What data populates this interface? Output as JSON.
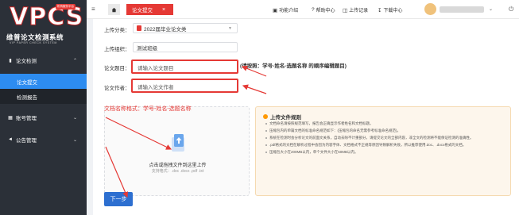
{
  "logo": {
    "brand": "VPCS",
    "badge": "机构服务平台",
    "name_cn": "维普论文检测系统",
    "name_en": "VIP PAPER CHECK SYSTEM"
  },
  "sidebar": {
    "menus": [
      {
        "label": "论文检测",
        "icon": "document-icon"
      },
      {
        "label": "账号管理",
        "icon": "user-card-icon"
      },
      {
        "label": "公告管理",
        "icon": "megaphone-icon"
      }
    ],
    "submenu": [
      {
        "label": "论文提交",
        "active": true
      },
      {
        "label": "检测报告",
        "active": false
      }
    ]
  },
  "topbar": {
    "menu_toggle": "≡",
    "active_tab": "论文提交",
    "tab_close": "×",
    "links": [
      {
        "label": "功能介绍",
        "icon": "feature-icon"
      },
      {
        "label": "帮助中心",
        "icon": "help-icon"
      },
      {
        "label": "上传记录",
        "icon": "upload-record-icon"
      },
      {
        "label": "下载中心",
        "icon": "download-icon"
      }
    ]
  },
  "form": {
    "category_label": "上传分类：",
    "category_value": "2022届毕业论文类",
    "org_label": "上传组织：",
    "org_value": "测试班级",
    "title_label": "论文题目：",
    "title_placeholder": "请输入论文题目",
    "title_hint": "(请按照：学号-姓名-选题名称 的顺序编辑题目)",
    "author_label": "论文作者：",
    "author_placeholder": "请输入论文作者",
    "format_note": "文档名称格式：学号-姓名-选题名称"
  },
  "upload": {
    "title": "点击或拖拽文件到这里上传",
    "formats": "支持格式：.doc .docx .pdf .txt"
  },
  "rules": {
    "title": "上传文件规则",
    "items": [
      "文档命名请按照规范填写，报告会正确显示作者姓名和文档标题。",
      "压缩包内的单篇文档的标准命名规范如下：(压缩包的命名无需参考标准命名规范)。",
      "系统在检测时会分析论文的前面文关系，自动去除不计重部分，请提交论文的全部内容，非全文的检测将不能保证检测的准确性。",
      ".pdf格式的文档在解析过程中会因为内容字体、文档格式不正规等原因导致解析失败，所以推荐使用.doc、.docx格式的文档。",
      "压缩包大小在200MB以内，单个文件大小在50MB以内。"
    ]
  },
  "buttons": {
    "next": "下一步"
  },
  "colors": {
    "sidebar_bg": "#2b3038",
    "accent_blue": "#2d8cf0",
    "tab_red": "#e53935",
    "highlight_red": "#e53935",
    "notice_bg": "#fdf6ec"
  }
}
